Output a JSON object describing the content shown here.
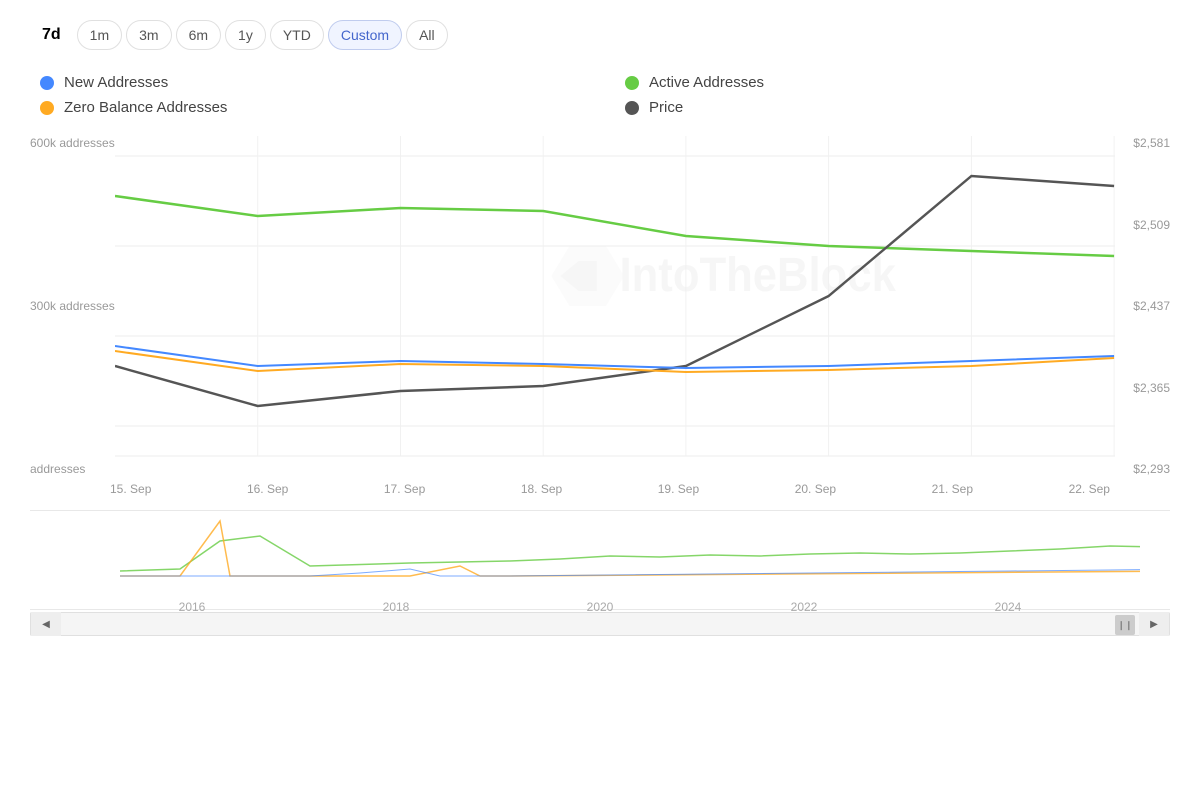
{
  "timeRange": {
    "buttons": [
      {
        "label": "7d",
        "active": true,
        "key": "7d"
      },
      {
        "label": "1m",
        "active": false,
        "key": "1m"
      },
      {
        "label": "3m",
        "active": false,
        "key": "3m"
      },
      {
        "label": "6m",
        "active": false,
        "key": "6m"
      },
      {
        "label": "1y",
        "active": false,
        "key": "1y"
      },
      {
        "label": "YTD",
        "active": false,
        "key": "ytd"
      },
      {
        "label": "Custom",
        "active": false,
        "key": "custom"
      },
      {
        "label": "All",
        "active": false,
        "key": "all"
      }
    ]
  },
  "legend": {
    "items": [
      {
        "label": "New Addresses",
        "color": "#4488ff",
        "position": "left"
      },
      {
        "label": "Active Addresses",
        "color": "#66cc44",
        "position": "right"
      },
      {
        "label": "Zero Balance Addresses",
        "color": "#ffaa22",
        "position": "left"
      },
      {
        "label": "Price",
        "color": "#555555",
        "position": "right"
      }
    ]
  },
  "yAxisLeft": {
    "labels": [
      "600k addresses",
      "300k addresses",
      "addresses"
    ]
  },
  "yAxisRight": {
    "labels": [
      "$2,581",
      "$2,509",
      "$2,437",
      "$2,365",
      "$2,293"
    ]
  },
  "xAxis": {
    "labels": [
      "15. Sep",
      "16. Sep",
      "17. Sep",
      "18. Sep",
      "19. Sep",
      "20. Sep",
      "21. Sep",
      "22. Sep"
    ]
  },
  "miniChart": {
    "years": [
      "2016",
      "2018",
      "2020",
      "2022",
      "2024"
    ]
  },
  "watermark": "IntoTheBlock"
}
